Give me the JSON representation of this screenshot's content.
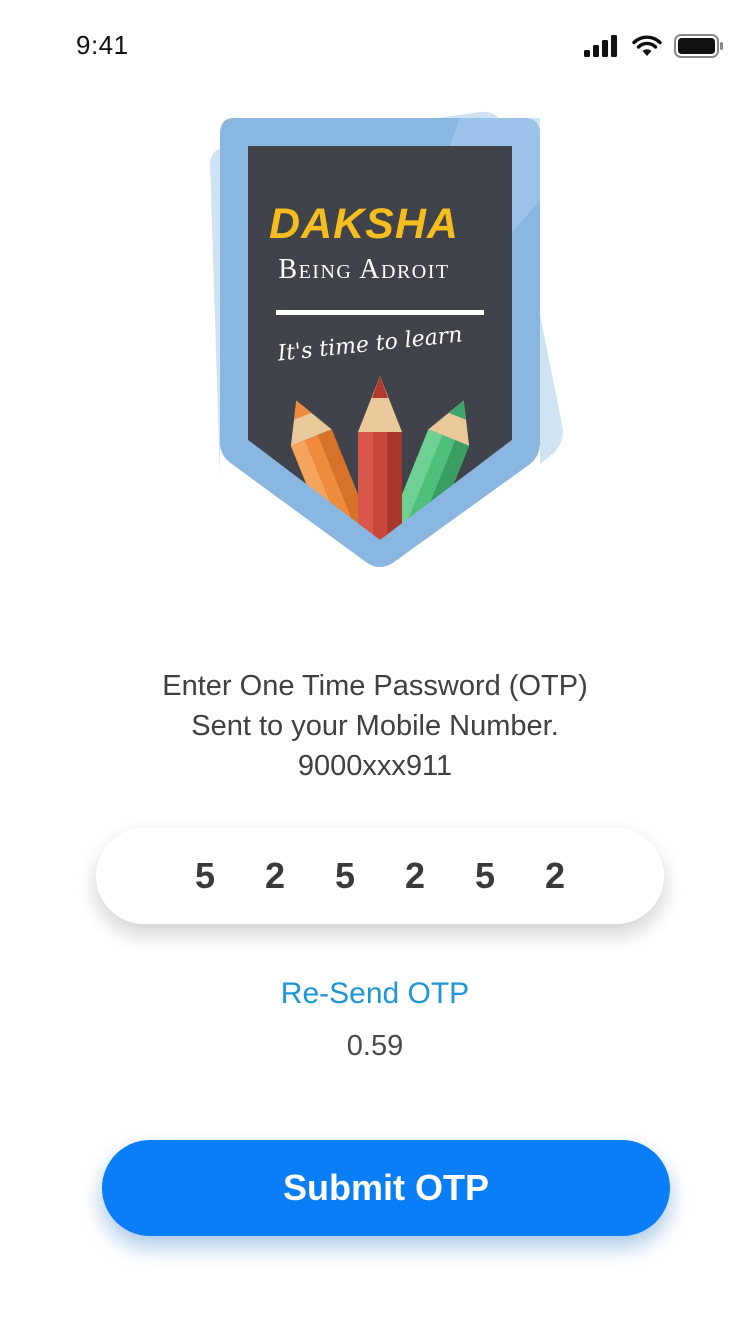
{
  "status_bar": {
    "time": "9:41",
    "icons": [
      "signal-icon",
      "wifi-icon",
      "battery-icon"
    ]
  },
  "logo": {
    "brand": "DAKSHA",
    "subtitle": "Being Adroit",
    "tagline": "It's time to learn",
    "colors": {
      "shield_outer": "#8ab6e2",
      "shield_back": "#c4dcf0",
      "board": "#404349",
      "brand": "#f5be1e"
    }
  },
  "otp_screen": {
    "instruction_line1": "Enter One Time Password (OTP)",
    "instruction_line2": "Sent to your Mobile Number.",
    "mobile_number": "9000xxx911",
    "otp_digits": [
      "5",
      "2",
      "5",
      "2",
      "5",
      "2"
    ],
    "resend_label": "Re-Send OTP",
    "timer": "0.59",
    "submit_label": "Submit OTP"
  },
  "colors": {
    "accent": "#0a7ef7",
    "link": "#1a96d9",
    "text": "#404040"
  }
}
